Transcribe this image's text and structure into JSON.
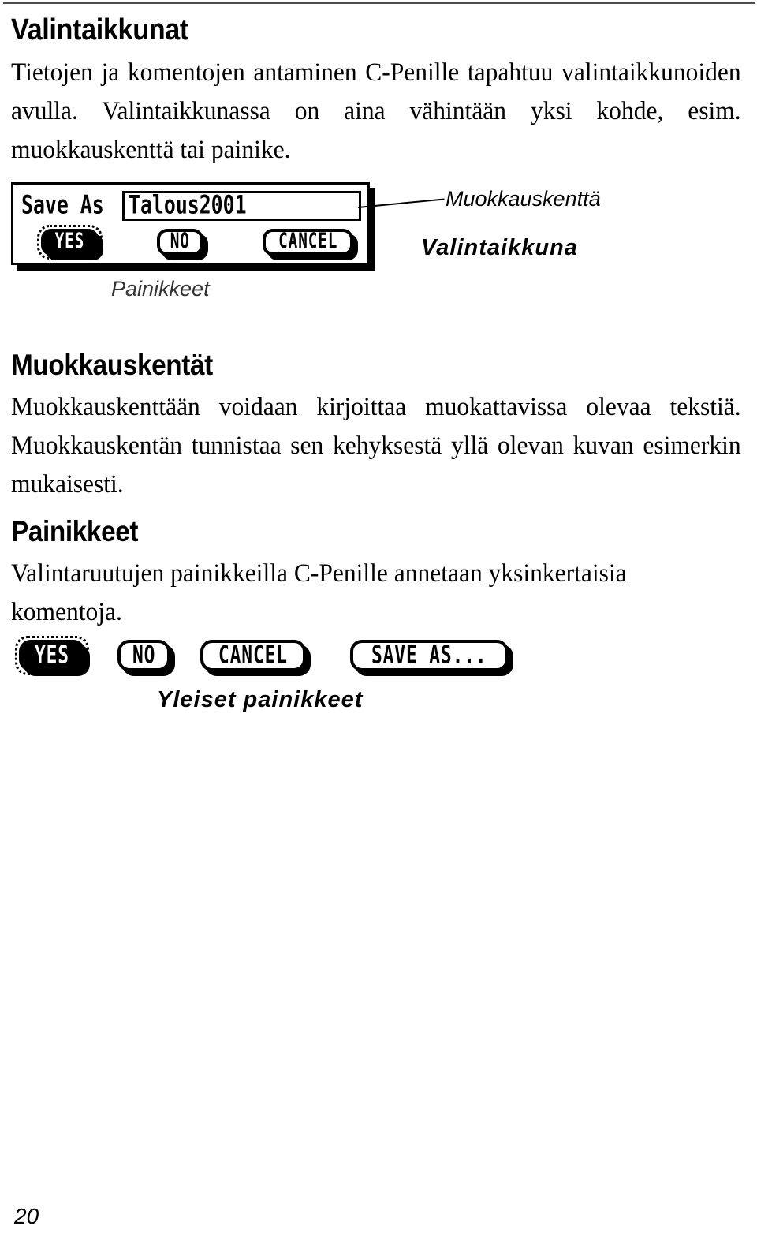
{
  "document": {
    "page_number": "20",
    "language": "fi"
  },
  "sections": [
    {
      "heading": "Valintaikkunat",
      "body": "Tietojen ja komentojen antaminen C-Penille tapahtuu valintaikkunoiden avulla. Valintaikkunassa on aina vähintään yksi kohde, esim. muokkauskenttä tai painike."
    },
    {
      "heading": "Muokkauskentät",
      "body": "Muokkauskenttään voidaan kirjoittaa muokattavissa olevaa tekstiä. Muokkauskentän tunnistaa sen kehyksestä yllä olevan kuvan esimerkin mukaisesti."
    },
    {
      "heading": "Painikkeet",
      "body": "Valintaruutujen painikkeilla C-Penille annetaan yksinkertaisia komentoja."
    }
  ],
  "dialog_figure": {
    "field_label": "Save As",
    "field_value": "Talous2001",
    "buttons": [
      {
        "label": "YES",
        "selected": true
      },
      {
        "label": "NO",
        "selected": false
      },
      {
        "label": "CANCEL",
        "selected": false
      }
    ],
    "callouts": {
      "edit_field": "Muokkauskenttä",
      "dialog": "Valintaikkuna",
      "buttons": "Painikkeet"
    }
  },
  "common_buttons_figure": {
    "caption": "Yleiset painikkeet",
    "buttons": [
      {
        "label": "YES",
        "selected": true
      },
      {
        "label": "NO",
        "selected": false
      },
      {
        "label": "CANCEL",
        "selected": false
      },
      {
        "label": "SAVE AS...",
        "selected": false
      }
    ]
  },
  "colors": {
    "ink": "#000000",
    "paper": "#ffffff",
    "rule": "#4d4d4d"
  }
}
